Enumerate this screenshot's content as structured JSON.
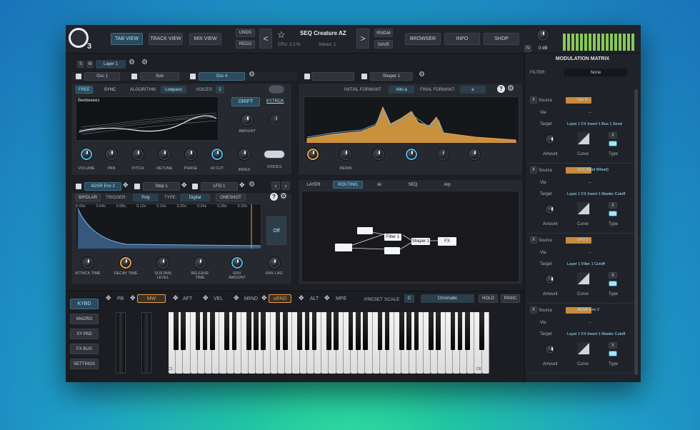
{
  "header": {
    "logo_text": "3",
    "view_tabs": [
      "TAB VIEW",
      "TRACK VIEW",
      "MIX VIEW"
    ],
    "undo": "UNDO",
    "redo": "REDO",
    "prev": "<",
    "next": ">",
    "preset_name": "SEQ Creature AZ",
    "cpu": "CPU: 2.2 %",
    "voices": "Voices: 1",
    "random": "RNDM",
    "save": "SAVE",
    "browser": "BROWSER",
    "info": "INFO",
    "shop": "SHOP",
    "master_n": "N",
    "master_db": "0 dB"
  },
  "layer": {
    "s": "S",
    "m": "M",
    "name": "Layer 1"
  },
  "osc_tabs": [
    "Osc 1",
    "Sub",
    "Osc 4"
  ],
  "shaper_tabs": [
    "",
    "Shaper 1"
  ],
  "osc": {
    "free": "FREE",
    "sync": "SYNC",
    "algorithm_label": "ALGORITHM:",
    "algorithm": "Lowpass",
    "voices_label": "VOICES:",
    "voices": "2",
    "wave_name": "Beebeeees",
    "drift": "DRIFT",
    "kytrck": "KYTRCK",
    "amount": "AMOUNT",
    "knobs": [
      "VOLUME",
      "PAN",
      "PITCH",
      "DETUNE",
      "PHASE",
      "HI CUT",
      "INDEX",
      "VOICES"
    ]
  },
  "shaper": {
    "initial_label": "INITIAL FORMANT:",
    "initial": "Alto a",
    "final_label": "FINAL FORMANT:",
    "final": "e",
    "knobs": [
      "RESIN",
      "",
      "",
      "",
      ""
    ]
  },
  "mod_tabs": [
    "ADSR Env 2",
    "Step 1",
    "LFO 1"
  ],
  "env": {
    "bipolar": "BIPOLAR",
    "trigger_label": "TRIGGER:",
    "trigger": "Poly",
    "type_label": "TYPE:",
    "type": "Digital",
    "oneshot": "ONESHOT",
    "times": [
      "0.00s",
      "0.04s",
      "0.08s",
      "0.12s",
      "0.16s",
      "0.20s",
      "0.24s",
      "0.28s",
      "0.32s"
    ],
    "off": "Off",
    "knobs": [
      "ATTACK TIME",
      "DECAY TIME",
      "SUSTAIN LEVEL",
      "RELEASE TIME",
      "ENV AMOUNT",
      "ENV LAG"
    ]
  },
  "routing": {
    "tabs": [
      "LAYER",
      "ROUTING",
      "vk",
      "SEQ",
      "Arp"
    ],
    "nodes": [
      "Filter 1",
      "Shaper 1",
      "FX"
    ]
  },
  "keyboard": {
    "side": [
      "KYBD",
      "MACRO",
      "XY PAD",
      "FX BUS",
      "SETTINGS"
    ],
    "ctrls": [
      "PB",
      "MW",
      "AFT",
      "VEL",
      "bRND",
      "uRND",
      "ALT",
      "MPE"
    ],
    "preset": "PRESET",
    "scale": "SCALE",
    "key": "C",
    "scale_value": "Chromatic",
    "hold": "HOLD",
    "panic": "PANIC",
    "c_low": "C1",
    "c_high": "C6"
  },
  "matrix": {
    "title": "MODULATION MATRIX",
    "filter_label": "FILTER:",
    "filter_value": "None",
    "source_label": "Source",
    "via_label": "Via",
    "target_label": "Target",
    "amount_label": "Amount",
    "curve_label": "Curve",
    "type_label": "Type",
    "x": "X",
    "dash": "--",
    "slots": [
      {
        "source": "Osc 4",
        "target": "Layer 1 FX Insert 1 Bus 1 Send"
      },
      {
        "source": "CC1 (Mod Wheel)",
        "target": "Layer 1 FX Insert 1 Master Cutoff"
      },
      {
        "source": "LFO 2",
        "target": "Layer 1 Filter 1 Cutoff"
      },
      {
        "source": "ADSR Env 2",
        "target": "Layer 1 FX Insert 1 Master Cutoff"
      }
    ]
  },
  "colors": {
    "accent": "#4fb5e8",
    "orange": "#e8a04a",
    "bg": "#1d1f25"
  }
}
